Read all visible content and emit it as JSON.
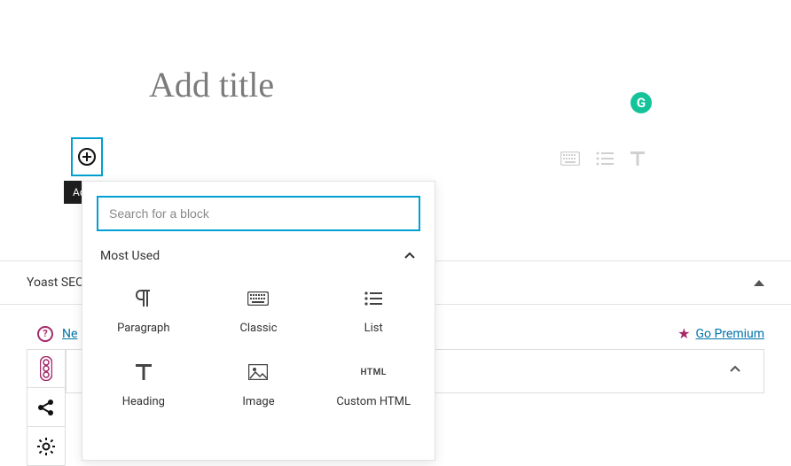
{
  "title_placeholder": "Add title",
  "grammarly_glyph": "G",
  "tooltip": "Add block",
  "search": {
    "placeholder": "Search for a block"
  },
  "section_header": "Most Used",
  "blocks": {
    "paragraph": "Paragraph",
    "classic": "Classic",
    "list": "List",
    "heading": "Heading",
    "image": "Image",
    "custom_html": "Custom HTML",
    "html_glyph": "HTML"
  },
  "yoast": {
    "title": "Yoast SEO"
  },
  "links": {
    "need_help": "Ne",
    "go_premium": "Go Premium"
  }
}
